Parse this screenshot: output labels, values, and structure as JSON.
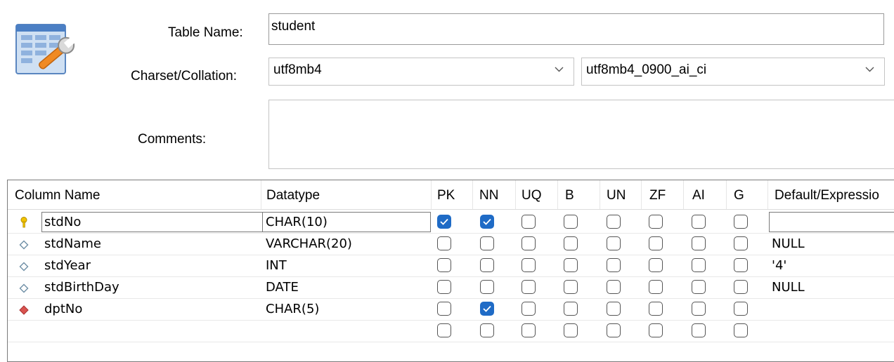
{
  "form": {
    "table_name_label": "Table Name:",
    "table_name_value": "student",
    "charset_label": "Charset/Collation:",
    "charset_value": "utf8mb4",
    "collation_value": "utf8mb4_0900_ai_ci",
    "comments_label": "Comments:",
    "comments_value": ""
  },
  "icons": {
    "table_icon": "table-wrench-icon",
    "chevron": "chevron-down-icon",
    "pk_key": "key-icon",
    "column_diamond": "diamond-outline-icon",
    "fk_diamond": "diamond-filled-icon"
  },
  "colors": {
    "checkbox_checked": "#1f6bc6",
    "fk_diamond": "#d9534f",
    "pk_key": "#f2c200"
  },
  "grid": {
    "headers": {
      "column_name": "Column Name",
      "datatype": "Datatype",
      "pk": "PK",
      "nn": "NN",
      "uq": "UQ",
      "b": "B",
      "un": "UN",
      "zf": "ZF",
      "ai": "AI",
      "g": "G",
      "default": "Default/Expressio"
    },
    "rows": [
      {
        "name": "stdNo",
        "datatype": "CHAR(10)",
        "default": "",
        "icon": "key-icon",
        "flags": {
          "pk": true,
          "nn": true,
          "uq": false,
          "b": false,
          "un": false,
          "zf": false,
          "ai": false,
          "g": false
        }
      },
      {
        "name": "stdName",
        "datatype": "VARCHAR(20)",
        "default": "NULL",
        "icon": "diamond-outline-icon",
        "flags": {
          "pk": false,
          "nn": false,
          "uq": false,
          "b": false,
          "un": false,
          "zf": false,
          "ai": false,
          "g": false
        }
      },
      {
        "name": "stdYear",
        "datatype": "INT",
        "default": "'4'",
        "icon": "diamond-outline-icon",
        "flags": {
          "pk": false,
          "nn": false,
          "uq": false,
          "b": false,
          "un": false,
          "zf": false,
          "ai": false,
          "g": false
        }
      },
      {
        "name": "stdBirthDay",
        "datatype": "DATE",
        "default": "NULL",
        "icon": "diamond-outline-icon",
        "flags": {
          "pk": false,
          "nn": false,
          "uq": false,
          "b": false,
          "un": false,
          "zf": false,
          "ai": false,
          "g": false
        }
      },
      {
        "name": "dptNo",
        "datatype": "CHAR(5)",
        "default": "",
        "icon": "diamond-filled-icon",
        "flags": {
          "pk": false,
          "nn": true,
          "uq": false,
          "b": false,
          "un": false,
          "zf": false,
          "ai": false,
          "g": false
        }
      },
      {
        "name": "",
        "datatype": "",
        "default": "",
        "icon": "",
        "flags": {
          "pk": false,
          "nn": false,
          "uq": false,
          "b": false,
          "un": false,
          "zf": false,
          "ai": false,
          "g": false
        }
      }
    ]
  }
}
